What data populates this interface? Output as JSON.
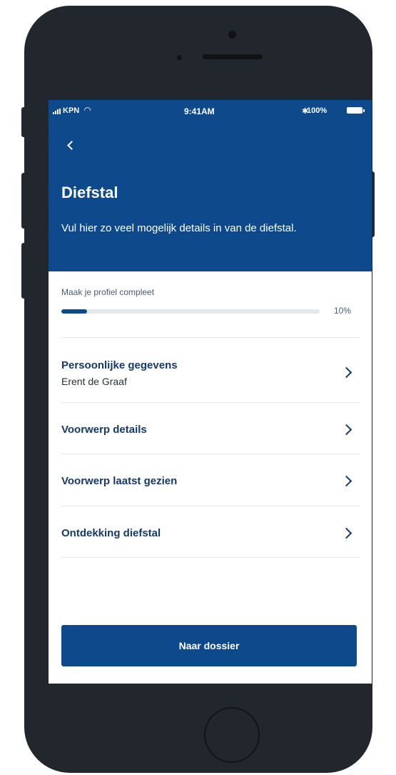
{
  "status_bar": {
    "carrier": "KPN",
    "time": "9:41AM",
    "battery": "100%"
  },
  "header": {
    "title": "Diefstal",
    "subtitle": "Vul hier zo veel mogelijk details in van de diefstal."
  },
  "progress": {
    "label": "Maak je profiel compleet",
    "percent_text": "10%",
    "value": 0.1
  },
  "list": {
    "items": [
      {
        "title": "Persoonlijke gegevens",
        "subtitle": "Erent de Graaf"
      },
      {
        "title": "Voorwerp details"
      },
      {
        "title": "Voorwerp laatst gezien"
      },
      {
        "title": "Ontdekking diefstal"
      }
    ]
  },
  "actions": {
    "primary_label": "Naar dossier"
  },
  "colors": {
    "brand_blue": "#0e4a8b",
    "device_body": "#22262d"
  },
  "icons": [
    "signal-icon",
    "wifi-icon",
    "bluetooth-icon",
    "battery-icon",
    "back-icon",
    "chevron-right-icon"
  ]
}
